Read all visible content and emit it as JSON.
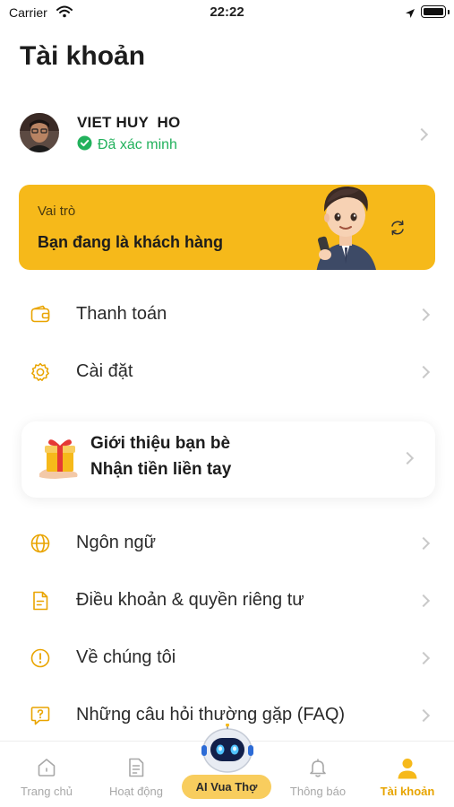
{
  "status_bar": {
    "carrier": "Carrier",
    "time": "22:22"
  },
  "page": {
    "title": "Tài khoản"
  },
  "profile": {
    "name": "VIET HUY  HO",
    "verified_label": "Đã xác minh"
  },
  "role_card": {
    "caption": "Vai trò",
    "value": "Bạn đang là khách hàng"
  },
  "menu": [
    {
      "label": "Thanh toán",
      "icon": "wallet-icon"
    },
    {
      "label": "Cài đặt",
      "icon": "gear-icon"
    }
  ],
  "referral": {
    "line1": "Giới thiệu bạn bè",
    "line2": "Nhận tiền liền tay",
    "icon": "gift-icon"
  },
  "menu2": [
    {
      "label": "Ngôn ngữ",
      "icon": "globe-icon"
    },
    {
      "label": "Điều khoản & quyền riêng tư",
      "icon": "document-icon"
    },
    {
      "label": "Về chúng tôi",
      "icon": "info-icon"
    },
    {
      "label": "Những câu hỏi thường gặp (FAQ)",
      "icon": "question-icon"
    }
  ],
  "tabs": [
    {
      "label": "Trang chủ",
      "icon": "home-icon",
      "active": false
    },
    {
      "label": "Hoạt động",
      "icon": "activity-icon",
      "active": false
    },
    {
      "label": "AI Vua Thợ",
      "icon": "robot-icon",
      "active": false
    },
    {
      "label": "Thông báo",
      "icon": "bell-icon",
      "active": false
    },
    {
      "label": "Tài khoản",
      "icon": "user-icon",
      "active": true
    }
  ],
  "colors": {
    "accent": "#F6B91A",
    "verified": "#22B15C",
    "tab_active": "#E7A400",
    "tab_inactive": "#A8A8A8"
  }
}
